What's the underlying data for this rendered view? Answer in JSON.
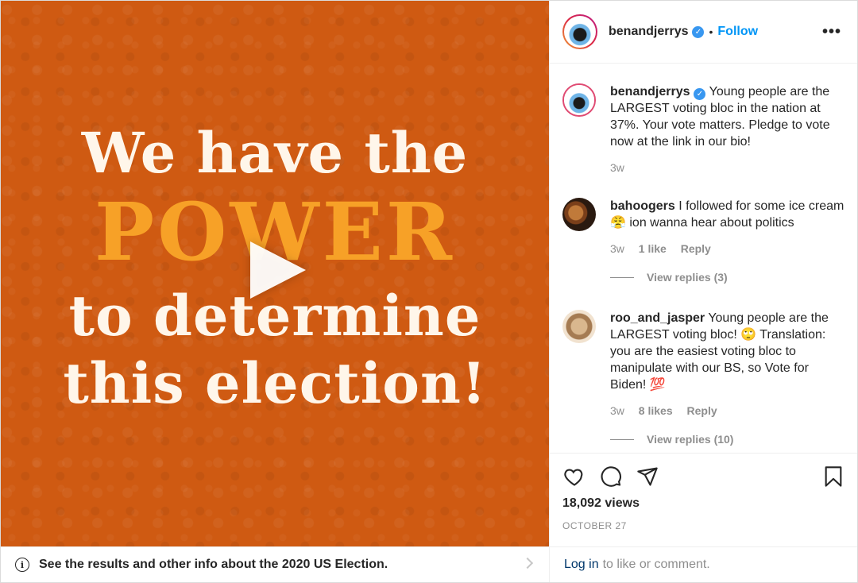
{
  "media": {
    "line1": "We have the",
    "line2": "POWER",
    "line3": "to determine",
    "line4": "this election!",
    "background_color": "#cf5a12",
    "accent_color": "#f7a127"
  },
  "banner": {
    "text": "See the results and other info about the 2020 US Election.",
    "icon": "info-icon"
  },
  "header": {
    "username": "benandjerrys",
    "follow_label": "Follow",
    "separator": "•",
    "more_label": "•••"
  },
  "comments": [
    {
      "username": "benandjerrys",
      "text": "Young people are the LARGEST voting bloc in the nation at 37%. Your vote matters. Pledge to vote now at the link in our bio!",
      "time": "3w"
    },
    {
      "username": "bahoogers",
      "text": "I followed for some ice cream 😤 ion wanna hear about politics",
      "time": "3w",
      "likes": "1 like",
      "reply_label": "Reply",
      "view_replies": "View replies (3)"
    },
    {
      "username": "roo_and_jasper",
      "text": "Young people are the LARGEST voting bloc! 🙄 Translation: you are the easiest voting bloc to manipulate with our BS, so Vote for Biden! 💯",
      "time": "3w",
      "likes": "8 likes",
      "reply_label": "Reply",
      "view_replies": "View replies (10)"
    }
  ],
  "actions": {
    "views": "18,092 views",
    "date": "OCTOBER 27",
    "icons": [
      "heart-icon",
      "comment-icon",
      "share-icon",
      "bookmark-icon"
    ]
  },
  "login": {
    "link": "Log in",
    "text": "to like or comment."
  }
}
